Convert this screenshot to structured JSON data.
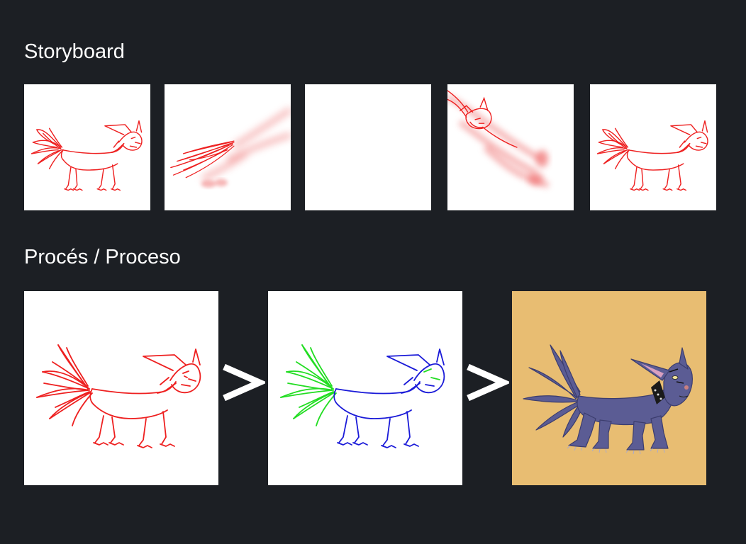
{
  "sections": {
    "storyboard_title": "Storyboard",
    "process_title": "Procés / Proceso"
  },
  "storyboard": {
    "frames": [
      {
        "kind": "sketch"
      },
      {
        "kind": "motion-blur-left"
      },
      {
        "kind": "blank"
      },
      {
        "kind": "motion-blur-right"
      },
      {
        "kind": "sketch"
      }
    ]
  },
  "process": {
    "steps": [
      {
        "kind": "red-sketch"
      },
      {
        "kind": "blue-green-lineart"
      },
      {
        "kind": "colored-final"
      }
    ],
    "separator_icon": "greater-than-arrow-icon"
  },
  "colors": {
    "background": "#1c1f24",
    "sketch_red": "#ee2020",
    "lineart_blue": "#1a1ad8",
    "lineart_green": "#22dd22",
    "creature_fill": "#5b5c94",
    "final_bg": "#e8bd72"
  }
}
